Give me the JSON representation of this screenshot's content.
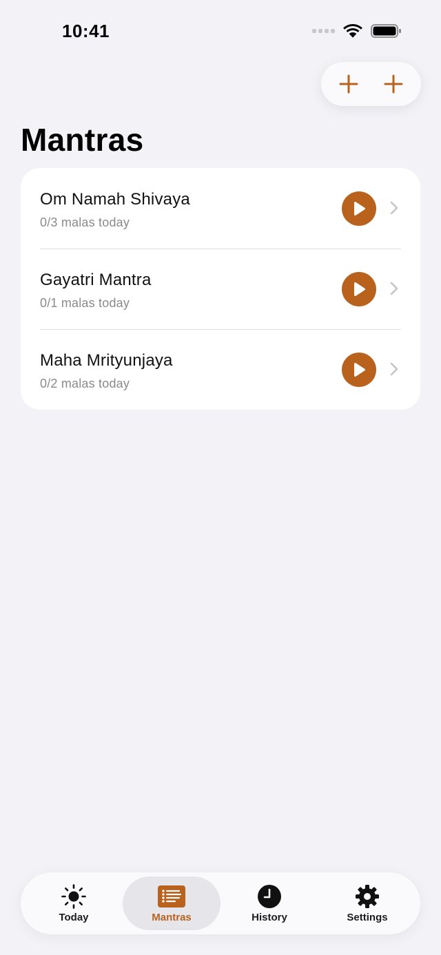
{
  "status_bar": {
    "time": "10:41"
  },
  "header": {
    "title": "Mantras",
    "actions": [
      {
        "icon": "plus-icon"
      },
      {
        "icon": "plus-icon"
      }
    ]
  },
  "mantras": [
    {
      "title": "Om Namah Shivaya",
      "progress": "0/3 malas today"
    },
    {
      "title": "Gayatri Mantra",
      "progress": "0/1 malas today"
    },
    {
      "title": "Maha Mrityunjaya",
      "progress": "0/2 malas today"
    }
  ],
  "tab_bar": {
    "tabs": [
      {
        "label": "Today",
        "icon": "sun-icon",
        "active": false
      },
      {
        "label": "Mantras",
        "icon": "list-icon",
        "active": true
      },
      {
        "label": "History",
        "icon": "clock-icon",
        "active": false
      },
      {
        "label": "Settings",
        "icon": "gear-icon",
        "active": false
      }
    ]
  },
  "colors": {
    "accent": "#b8621e",
    "background": "#f2f2f7",
    "card": "#ffffff"
  }
}
